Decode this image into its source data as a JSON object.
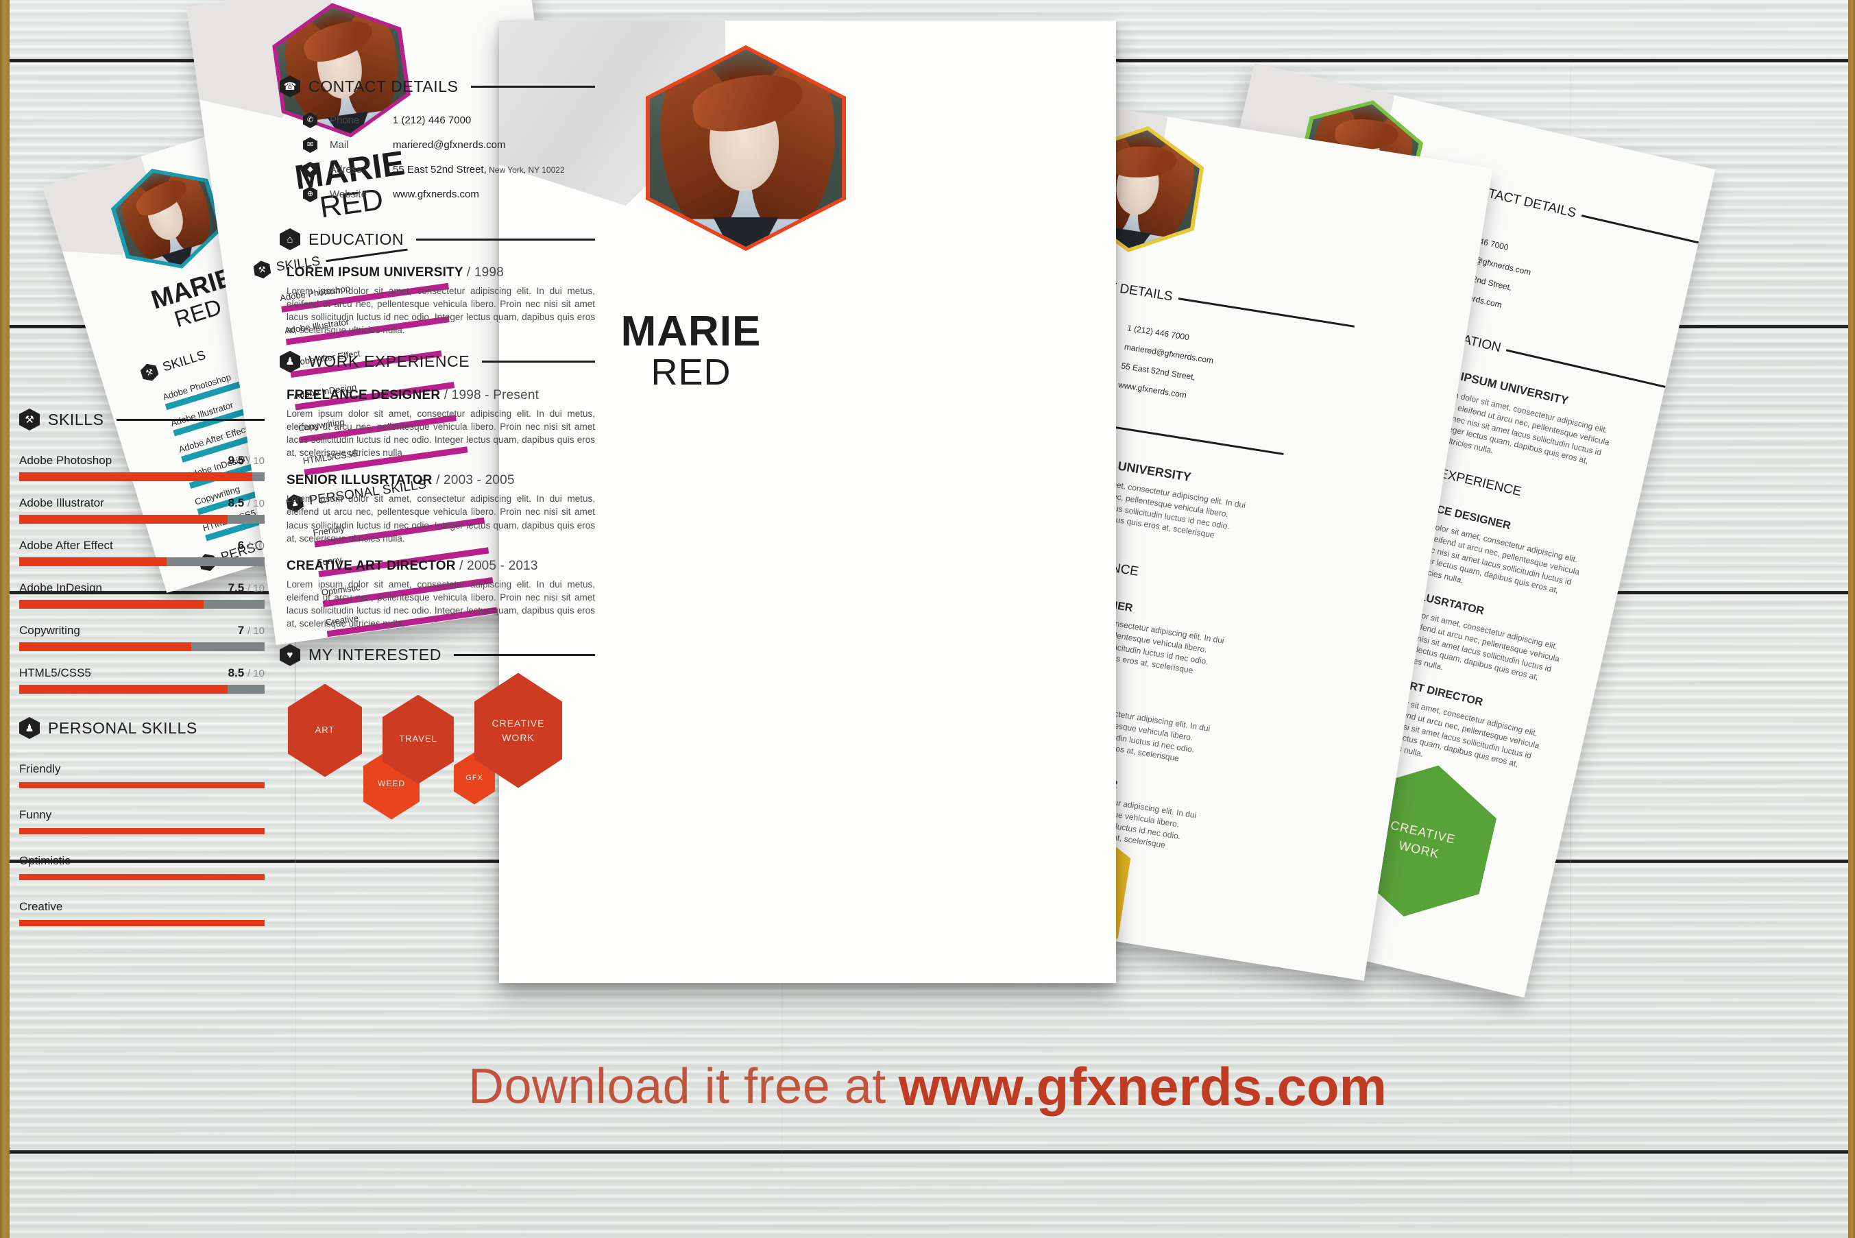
{
  "person": {
    "first_name": "MARIE",
    "last_name": "RED"
  },
  "sections": {
    "contact": "CONTACT DETAILS",
    "education": "EDUCATION",
    "work": "WORK EXPERIENCE",
    "skills": "SKILLS",
    "personal_skills": "PERSONAL SKILLS",
    "interests": "MY INTERESTED"
  },
  "icons": {
    "contact": "phone-icon",
    "education": "graduation-cap-icon",
    "work": "briefcase-icon",
    "skills": "tools-icon",
    "personal": "people-icon",
    "interests": "heart-icon",
    "phone": "mobile-icon",
    "mail": "envelope-icon",
    "address": "map-pin-icon",
    "website": "globe-icon"
  },
  "icon_glyphs": {
    "contact": "☎",
    "education": "⌂",
    "work": "♟",
    "skills": "⚒",
    "personal": "♟",
    "interests": "♥",
    "phone": "✆",
    "mail": "✉",
    "address": "◆",
    "website": "⊕"
  },
  "contact": [
    {
      "label": "Phone",
      "value": "1 (212) 446 7000",
      "small": ""
    },
    {
      "label": "Mail",
      "value": "mariered@gfxnerds.com",
      "small": ""
    },
    {
      "label": "Adress",
      "value": "55 East 52nd Street,",
      "small": " New York, NY 10022"
    },
    {
      "label": "Website",
      "value": "www.gfxnerds.com",
      "small": ""
    }
  ],
  "education": [
    {
      "title": "LOREM IPSUM UNIVERSITY",
      "period": "/ 1998",
      "body": "Lorem ipsum dolor sit amet, consectetur adipiscing elit. In dui metus, eleifend ut arcu nec, pellentesque vehicula libero. Proin nec nisi sit amet lacus sollicitudin luctus id nec odio. Integer lectus quam, dapibus quis eros at, scelerisque ultricies nulla."
    }
  ],
  "work": [
    {
      "title": "FREELANCE DESIGNER",
      "period": "/ 1998 - Present",
      "body": "Lorem ipsum dolor sit amet, consectetur adipiscing elit. In dui metus, eleifend ut arcu nec, pellentesque vehicula libero. Proin nec nisi sit amet lacus sollicitudin luctus id nec odio. Integer lectus quam, dapibus quis eros at, scelerisque ultricies nulla."
    },
    {
      "title": "SENIOR ILLUSRTATOR",
      "period": "/ 2003 - 2005",
      "body": "Lorem ipsum dolor sit amet, consectetur adipiscing elit. In dui metus, eleifend ut arcu nec, pellentesque vehicula libero. Proin nec nisi sit amet lacus sollicitudin luctus id nec odio. Integer lectus quam, dapibus quis eros at, scelerisque ultricies nulla."
    },
    {
      "title": "CREATIVE ART DIRECTOR",
      "period": "/ 2005 - 2013",
      "body": "Lorem ipsum dolor sit amet, consectetur adipiscing elit. In dui metus, eleifend ut arcu nec, pellentesque vehicula libero. Proin nec nisi sit amet lacus sollicitudin luctus id nec odio. Integer lectus quam, dapibus quis eros at, scelerisque ultricies nulla."
    }
  ],
  "chart_data": {
    "type": "bar",
    "title": "SKILLS",
    "xlabel": "",
    "ylabel": "",
    "ylim": [
      0,
      10
    ],
    "scale_suffix": "/ 10",
    "categories": [
      "Adobe Photoshop",
      "Adobe Illustrator",
      "Adobe After Effect",
      "Adobe InDesign",
      "Copywriting",
      "HTML5/CSS5"
    ],
    "values": [
      9.5,
      8.5,
      6,
      7.5,
      7,
      8.5
    ],
    "value_labels": [
      "9.5",
      "8.5",
      "6",
      "7.5",
      "7",
      "8.5"
    ],
    "bar_color": "#e33a1a",
    "track_color": "#7f8487",
    "grid": false,
    "legend": "none"
  },
  "skills": [
    {
      "name": "Adobe Photoshop",
      "value": "9.5",
      "den": "/ 10",
      "pct": 95
    },
    {
      "name": "Adobe Illustrator",
      "value": "8.5",
      "den": "/ 10",
      "pct": 85
    },
    {
      "name": "Adobe After Effect",
      "value": "6",
      "den": "/ 10",
      "pct": 60
    },
    {
      "name": "Adobe InDesign",
      "value": "7.5",
      "den": "/ 10",
      "pct": 75
    },
    {
      "name": "Copywriting",
      "value": "7",
      "den": "/ 10",
      "pct": 70
    },
    {
      "name": "HTML5/CSS5",
      "value": "8.5",
      "den": "/ 10",
      "pct": 85
    }
  ],
  "personal_skills": [
    {
      "name": "Friendly"
    },
    {
      "name": "Funny"
    },
    {
      "name": "Optimistic"
    },
    {
      "name": "Creative"
    }
  ],
  "interests": [
    {
      "label": "ART",
      "size": "large"
    },
    {
      "label": "TRAVEL",
      "size": "large"
    },
    {
      "label": "CREATIVE WORK",
      "size": "large"
    },
    {
      "label": "WEED",
      "size": "small"
    },
    {
      "label": "GFX",
      "size": "small"
    }
  ],
  "interest_labels": {
    "art": "ART",
    "travel": "TRAVEL",
    "creative_l1": "CREATIVE",
    "creative_l2": "WORK",
    "weed": "WEED",
    "gfx": "GFX"
  },
  "footer": {
    "lead": "Download it free at",
    "url": "www.gfxnerds.com"
  },
  "colors": {
    "accent_red": "#e33a1a",
    "hex_dark_red": "#cc3b22",
    "hex_light_red": "#e8441e",
    "teal": "#1a9bae",
    "purple": "#b8208c",
    "yellow": "#e0b520",
    "green": "#58a23a",
    "track_grey": "#7f8487",
    "footer_lead": "#c0543c",
    "footer_url": "#bf3b21"
  }
}
